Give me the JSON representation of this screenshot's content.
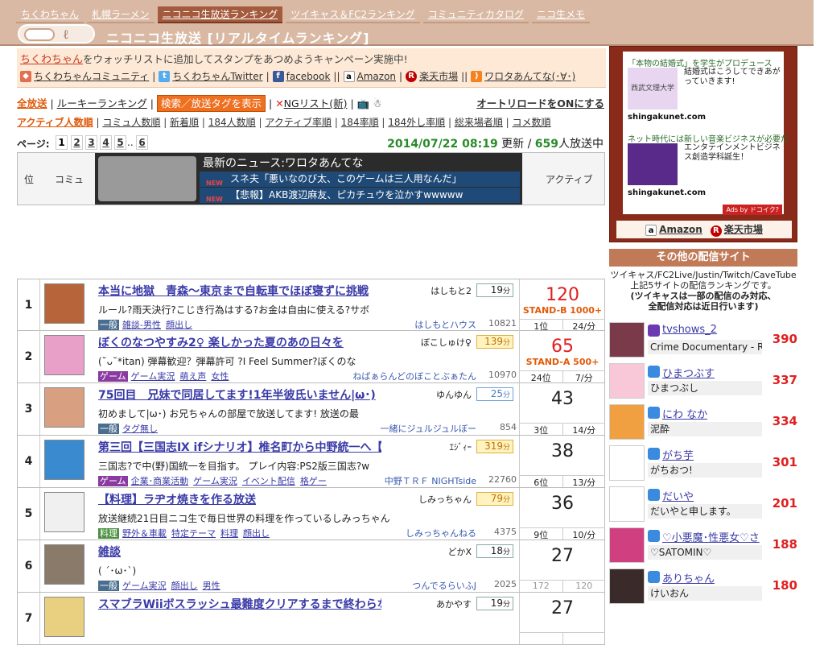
{
  "nav": {
    "tabs": [
      {
        "label": "ちくわちゃん"
      },
      {
        "label": "札幌ラーメン"
      },
      {
        "label": "ニコニコ生放送ランキング"
      },
      {
        "label": "ツイキャス＆FC2ランキング"
      },
      {
        "label": "コミュニティカタログ"
      },
      {
        "label": "ニコ生メモ"
      }
    ],
    "site_title": "ニコニコ生放送 [リアルタイムランキング]"
  },
  "notice": {
    "campaign_highlight": "ちくわちゃん",
    "campaign_text": "をウォッチリストに追加してスタンプをあつめようキャンペーン実施中!",
    "links": [
      "ちくわちゃんコミュニティ",
      "ちくわちゃんTwitter",
      "facebook",
      "Amazon",
      "楽天市場",
      "ワロタあんてな(･∀･)"
    ]
  },
  "controls": {
    "all": "全放送",
    "rookie": "ルーキーランキング",
    "tag_button": "検索／放送タグを表示",
    "ng": "NGリスト(新)",
    "auto_reload": "オートリロードをONにする"
  },
  "sort": {
    "items": [
      "アクティブ人数順",
      "コミュ人数順",
      "新着順",
      "184人数順",
      "アクティブ率順",
      "184率順",
      "184外し率順",
      "総来場者順",
      "コメ数順"
    ]
  },
  "pager": {
    "label": "ページ:",
    "pages": [
      "1",
      "2",
      "3",
      "4",
      "5",
      "..",
      "6"
    ],
    "datetime": "2014/07/22 08:19",
    "updated": "更新 /",
    "count": "659",
    "count_suffix": "人放送中"
  },
  "table_header": {
    "rank": "位",
    "community": "コミュ",
    "active": "アクティブ",
    "news_title": "最新のニュース:ワロタあんてな",
    "news": [
      "スネ夫「悪いなのび太、このゲームは三人用なんだ」",
      "【悲報】AKB渡辺麻友、ピカチュウを泣かすwwwww"
    ],
    "news_badge": "NEW"
  },
  "rows": [
    {
      "rank": "1",
      "title": "本当に地獄　青森〜東京まで自転車でほぼ寝ずに挑戦",
      "owner": "はしもと2",
      "min": "19",
      "desc": "ルール?雨天決行?こじき行為はする?お金は自由に使える?サボ",
      "cat": "一般",
      "tags": [
        "雑談-男性",
        "顔出し"
      ],
      "comm": "はしもとハウス",
      "cnum": "10821",
      "active": "120",
      "stand": "STAND-B 1000+",
      "sub1": "1位",
      "sub2": "24/分"
    },
    {
      "rank": "2",
      "title": "ぼくのなつやすみ2♀ 楽しかった夏のあの日々を",
      "owner": "ぼこしゅけ♀",
      "min": "139",
      "desc": "(˘ᴗ˘*itan) 弾幕歓迎？弾幕許可 ?I Feel Summer?ぼくのな",
      "cat": "ゲーム",
      "tags": [
        "ゲーム実況",
        "萌え声",
        "女性"
      ],
      "comm": "ねばぁらんどのぼことぶぁたん",
      "cnum": "10970",
      "active": "65",
      "stand": "STAND-A 500+",
      "sub1": "24位",
      "sub2": "7/分"
    },
    {
      "rank": "3",
      "title": "75回目　兄妹で同居してます!1年半彼氏いません|ω･)",
      "owner": "ゆんゆん",
      "min": "25",
      "desc": "初めまして|ω･) お兄ちゃんの部屋で放送してます! 放送の最",
      "cat": "一般",
      "tags": [
        "タグ無し"
      ],
      "comm": "一緒にジュルジュルぼー",
      "cnum": "854",
      "active": "43",
      "stand": "",
      "sub1": "3位",
      "sub2": "14/分"
    },
    {
      "rank": "4",
      "title": "第三回【三国志Ⅸ ifシナリオ】椎名町から中野統一へ【と",
      "owner": "ｴｼﾞｨｰ",
      "min": "319",
      "desc": "三国志?で中(野)国統一を目指す。 プレイ内容:PS2版三国志?w",
      "cat": "ゲーム",
      "tags": [
        "企業･商業活動",
        "ゲーム実況",
        "イベント配信",
        "格ゲー"
      ],
      "comm": "中野ＴＲＦ NIGHTside",
      "cnum": "22760",
      "active": "38",
      "stand": "",
      "sub1": "6位",
      "sub2": "13/分"
    },
    {
      "rank": "5",
      "title": "【料理】ラヂオ焼きを作る放送",
      "owner": "しみっちゃん",
      "min": "79",
      "desc": "放送継続21日目ニコ生で毎日世界の料理を作っているしみっちゃん",
      "cat": "料理",
      "tags": [
        "野外＆車載",
        "特定テーマ",
        "料理",
        "顔出し"
      ],
      "comm": "しみっちゃんねる",
      "cnum": "4375",
      "active": "36",
      "stand": "",
      "sub1": "9位",
      "sub2": "10/分"
    },
    {
      "rank": "6",
      "title": "雑談",
      "owner": "どかX",
      "min": "18",
      "desc": "( ´･ω･`)",
      "cat": "一般",
      "tags": [
        "ゲーム実況",
        "顔出し",
        "男性"
      ],
      "comm": "つんでるらいふJ",
      "cnum": "2025",
      "active": "27",
      "stand": "",
      "sub1": "172",
      "sub2": "120"
    },
    {
      "rank": "7",
      "title": "スマブラWiiボスラッシュ最難度クリアするまで終わらない",
      "owner": "あかやす",
      "min": "19",
      "desc": "",
      "cat": "",
      "tags": [],
      "comm": "",
      "cnum": "",
      "active": "27",
      "stand": "",
      "sub1": "",
      "sub2": ""
    }
  ],
  "sidebar": {
    "ad1": {
      "head": "「本物の結婚式」を学生がプロデュース",
      "text": "結婚式はこうしてできあがっていきます!",
      "url": "shingakunet.com",
      "img_label": "西武文理大学"
    },
    "ad2": {
      "head": "ネット時代には新しい音楽ビジネスが必要だ",
      "text": "エンタテインメントビジネス創造学科誕生！",
      "url": "shingakunet.com"
    },
    "ads_by": "Ads by ドコイク?",
    "shop": [
      "Amazon",
      "楽天市場"
    ],
    "other_heading": "その他の配信サイト",
    "other_desc1": "ツイキャス/FC2Live/Justin/Twitch/CaveTube",
    "other_desc2": "上記5サイトの配信ランキングです。",
    "other_desc3": "(ツイキャスは一部の配信のみ対応、",
    "other_desc4": "全配信対応は近日行います)",
    "streams": [
      {
        "name": "tvshows_2",
        "title": "Crime Documentary - Ran",
        "count": "390",
        "icon": "justin-icon"
      },
      {
        "name": "ひまつぶす",
        "title": "ひまつぶし",
        "count": "337",
        "icon": "twitcasting-icon"
      },
      {
        "name": "にわ なか",
        "title": "泥酔",
        "count": "334",
        "icon": "twitcasting-icon"
      },
      {
        "name": "がち芋",
        "title": "がちおつ!",
        "count": "301",
        "icon": "twitcasting-icon"
      },
      {
        "name": "だいや",
        "title": "だいやと申します。",
        "count": "201",
        "icon": "twitcasting-icon"
      },
      {
        "name": "♡小悪魔･性悪女♡さ",
        "title": "♡SATOMIN♡",
        "count": "188",
        "icon": "twitcasting-icon"
      },
      {
        "name": "ありちゃん",
        "title": "けいおん",
        "count": "180",
        "icon": "twitcasting-icon"
      }
    ]
  },
  "colors": {
    "header": "#d9b9a3",
    "accent": "#e05a0a",
    "active_red": "#e02020",
    "sidebar_ad": "#8a2a1a"
  }
}
